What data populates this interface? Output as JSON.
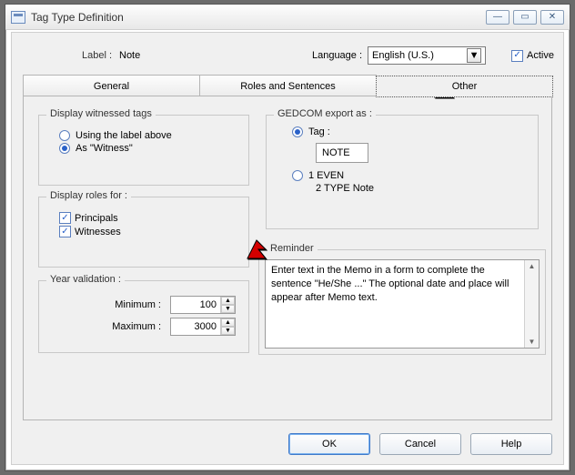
{
  "window": {
    "title": "Tag Type Definition"
  },
  "header": {
    "label_caption": "Label :",
    "label_value": "Note",
    "language_caption": "Language :",
    "language_value": "English (U.S.)",
    "active_label": "Active"
  },
  "tabs": {
    "general": "General",
    "roles": "Roles and Sentences",
    "other": "Other"
  },
  "witnessed": {
    "legend": "Display witnessed tags",
    "opt_label": "Using the label above",
    "opt_witness": "As \"Witness\""
  },
  "rolesfor": {
    "legend": "Display roles for :",
    "principals": "Principals",
    "witnesses": "Witnesses"
  },
  "yearval": {
    "legend": "Year validation :",
    "min_label": "Minimum :",
    "min_value": "100",
    "max_label": "Maximum :",
    "max_value": "3000"
  },
  "gedcom": {
    "legend": "GEDCOM export as :",
    "opt_tag": "Tag :",
    "tag_value": "NOTE",
    "opt_even": "1 EVEN",
    "sub_type": "2 TYPE Note"
  },
  "reminder": {
    "legend": "Reminder",
    "text": "Enter text in the Memo in a form to complete the sentence \"He/She ...\" The optional date and place will appear after Memo text."
  },
  "buttons": {
    "ok": "OK",
    "cancel": "Cancel",
    "help": "Help"
  },
  "glyphs": {
    "check": "✓",
    "down": "▼",
    "up": "▲"
  }
}
